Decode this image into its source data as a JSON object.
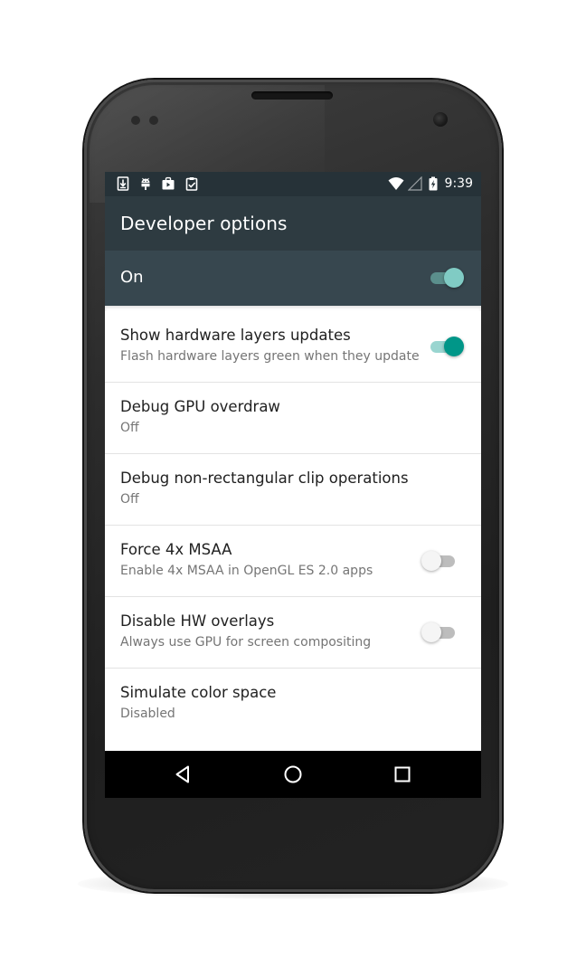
{
  "status_bar": {
    "time": "9:39",
    "icons": [
      "download-icon",
      "android-debug-icon",
      "play-store-icon",
      "clipboard-check-icon",
      "wifi-icon",
      "cell-signal-icon",
      "battery-charging-icon"
    ]
  },
  "app_bar": {
    "title": "Developer options"
  },
  "master_switch": {
    "label": "On",
    "checked": true
  },
  "settings": [
    {
      "title": "Show hardware layers updates",
      "summary": "Flash hardware layers green when they update",
      "toggle": true,
      "checked": true
    },
    {
      "title": "Debug GPU overdraw",
      "summary": "Off",
      "toggle": false
    },
    {
      "title": "Debug non-rectangular clip operations",
      "summary": "Off",
      "toggle": false
    },
    {
      "title": "Force 4x MSAA",
      "summary": "Enable 4x MSAA in OpenGL ES 2.0 apps",
      "toggle": true,
      "checked": false
    },
    {
      "title": "Disable HW overlays",
      "summary": "Always use GPU for screen compositing",
      "toggle": true,
      "checked": false
    },
    {
      "title": "Simulate color space",
      "summary": "Disabled",
      "toggle": false
    }
  ],
  "nav_bar": {
    "buttons": [
      "back-icon",
      "home-icon",
      "recents-icon"
    ]
  },
  "colors": {
    "status_bar": "#263238",
    "app_bar": "#2e3b41",
    "master_bar": "#37474f",
    "accent": "#009688"
  }
}
